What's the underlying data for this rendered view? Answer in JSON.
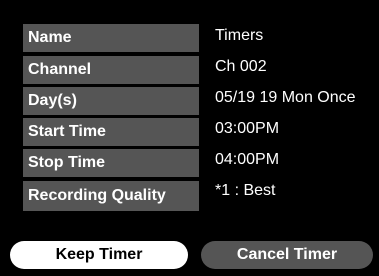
{
  "fields": [
    {
      "label": "Name",
      "value": "Timers"
    },
    {
      "label": "Channel",
      "value": "Ch 002"
    },
    {
      "label": "Day(s)",
      "value": "05/19 19 Mon Once"
    },
    {
      "label": "Start Time",
      "value": "03:00PM"
    },
    {
      "label": "Stop Time",
      "value": "04:00PM"
    },
    {
      "label": "Recording Quality",
      "value": "*1 : Best"
    }
  ],
  "buttons": {
    "keep_label": "Keep Timer",
    "cancel_label": "Cancel Timer"
  },
  "colors": {
    "background": "#000000",
    "label_bg": "#555555",
    "text": "#ffffff",
    "selected_button_bg": "#ffffff",
    "selected_button_text": "#000000",
    "button_bg": "#555555"
  }
}
